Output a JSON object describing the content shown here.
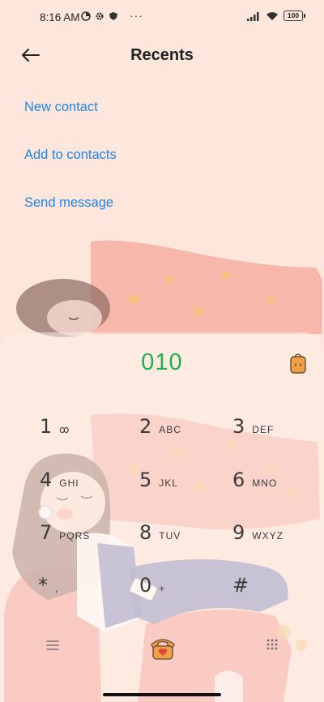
{
  "status_bar": {
    "time": "8:16 AM",
    "more": "···",
    "battery": "100"
  },
  "header": {
    "title": "Recents"
  },
  "actions": [
    {
      "label": "New contact"
    },
    {
      "label": "Add to contacts"
    },
    {
      "label": "Send message"
    }
  ],
  "dialer": {
    "number": "010",
    "keys": [
      {
        "digit": "1",
        "letters": "ꝏ"
      },
      {
        "digit": "2",
        "letters": "ABC"
      },
      {
        "digit": "3",
        "letters": "DEF"
      },
      {
        "digit": "4",
        "letters": "GHI"
      },
      {
        "digit": "5",
        "letters": "JKL"
      },
      {
        "digit": "6",
        "letters": "MNO"
      },
      {
        "digit": "7",
        "letters": "PQRS"
      },
      {
        "digit": "8",
        "letters": "TUV"
      },
      {
        "digit": "9",
        "letters": "WXYZ"
      },
      {
        "digit": "*",
        "letters": ","
      },
      {
        "digit": "0",
        "letters": "+"
      },
      {
        "digit": "#",
        "letters": ""
      }
    ]
  },
  "colors": {
    "background": "#fde6dc",
    "link": "#1f86e6",
    "number": "#22b04e",
    "call_button": "#f0a04a"
  },
  "icons": [
    "back-arrow-icon",
    "paste-icon",
    "menu-icon",
    "call-icon",
    "dialpad-icon"
  ]
}
